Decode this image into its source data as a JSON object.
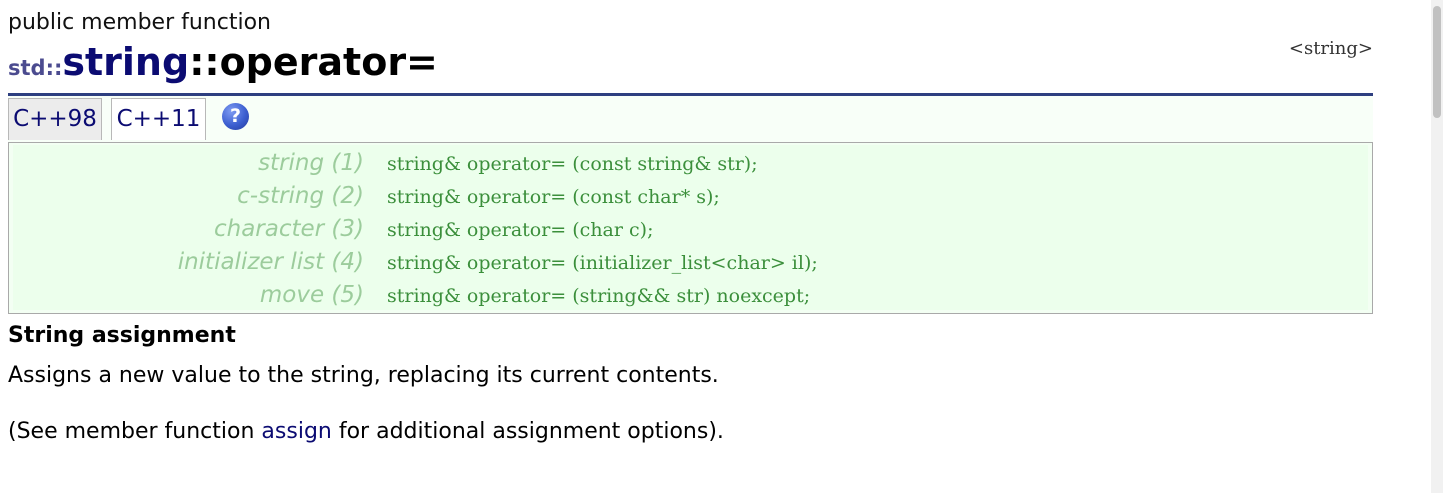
{
  "page": {
    "kind": "public member function",
    "title": {
      "namespace": "std::",
      "class_name": "string",
      "member": "::operator="
    },
    "header_file": "<string>"
  },
  "tabs": [
    {
      "label": "C++98"
    },
    {
      "label": "C++11"
    }
  ],
  "help_icon": "?",
  "prototypes": [
    {
      "label": "string (1)",
      "code": "string& operator= (const string& str);"
    },
    {
      "label": "c-string (2)",
      "code": "string& operator= (const char* s);"
    },
    {
      "label": "character (3)",
      "code": "string& operator= (char c);"
    },
    {
      "label": "initializer list (4)",
      "code": "string& operator= (initializer_list<char> il);"
    },
    {
      "label": "move (5)",
      "code": "string& operator= (string&& str) noexcept;"
    }
  ],
  "description": {
    "heading": "String assignment",
    "paragraph1": "Assigns a new value to the string, replacing its current contents.",
    "paragraph2_before": "(See member function ",
    "paragraph2_link": "assign",
    "paragraph2_after": " for additional assignment options)."
  },
  "colors": {
    "accent": "#0b0b72",
    "rule": "#2e3f80",
    "proto_label": "#9ccc9c",
    "proto_code": "#3b8f3b"
  }
}
